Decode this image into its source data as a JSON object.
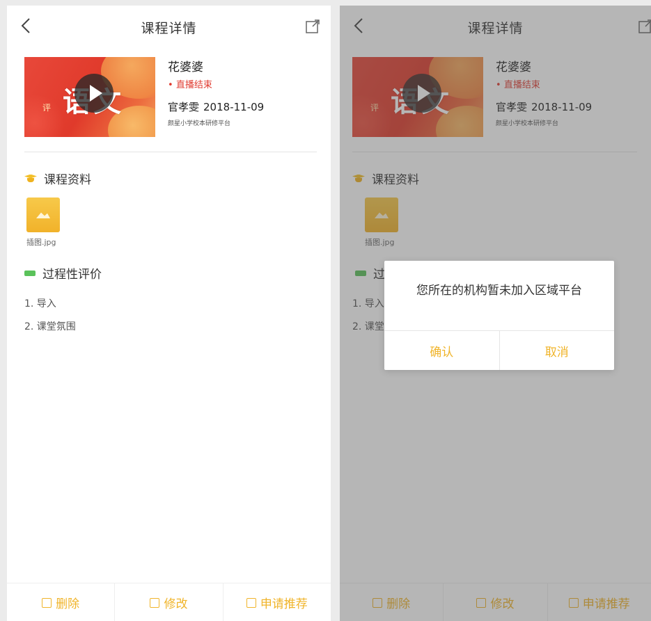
{
  "nav": {
    "title": "课程详情"
  },
  "course": {
    "name": "花婆婆",
    "status": "直播结束",
    "teacher": "官孝雯",
    "date": "2018-11-09",
    "platform": "颜星小学校本研修平台",
    "thumb_text": "语文",
    "thumb_small_text": "评"
  },
  "sections": {
    "materials": {
      "label": "课程资料"
    },
    "evaluation": {
      "label": "过程性评价"
    }
  },
  "file": {
    "name": "插图.jpg"
  },
  "evaluation_items": [
    "1. 导入",
    "2. 课堂氛围"
  ],
  "bottom": {
    "delete": "删除",
    "edit": "修改",
    "recommend": "申请推荐"
  },
  "dialog": {
    "message": "您所在的机构暂未加入区域平台",
    "confirm": "确认",
    "cancel": "取消"
  },
  "colors": {
    "accent": "#f0b42a",
    "status_red": "#e03c31",
    "eval_green": "#5ac25a",
    "materials_yellow": "#f3c02a"
  }
}
